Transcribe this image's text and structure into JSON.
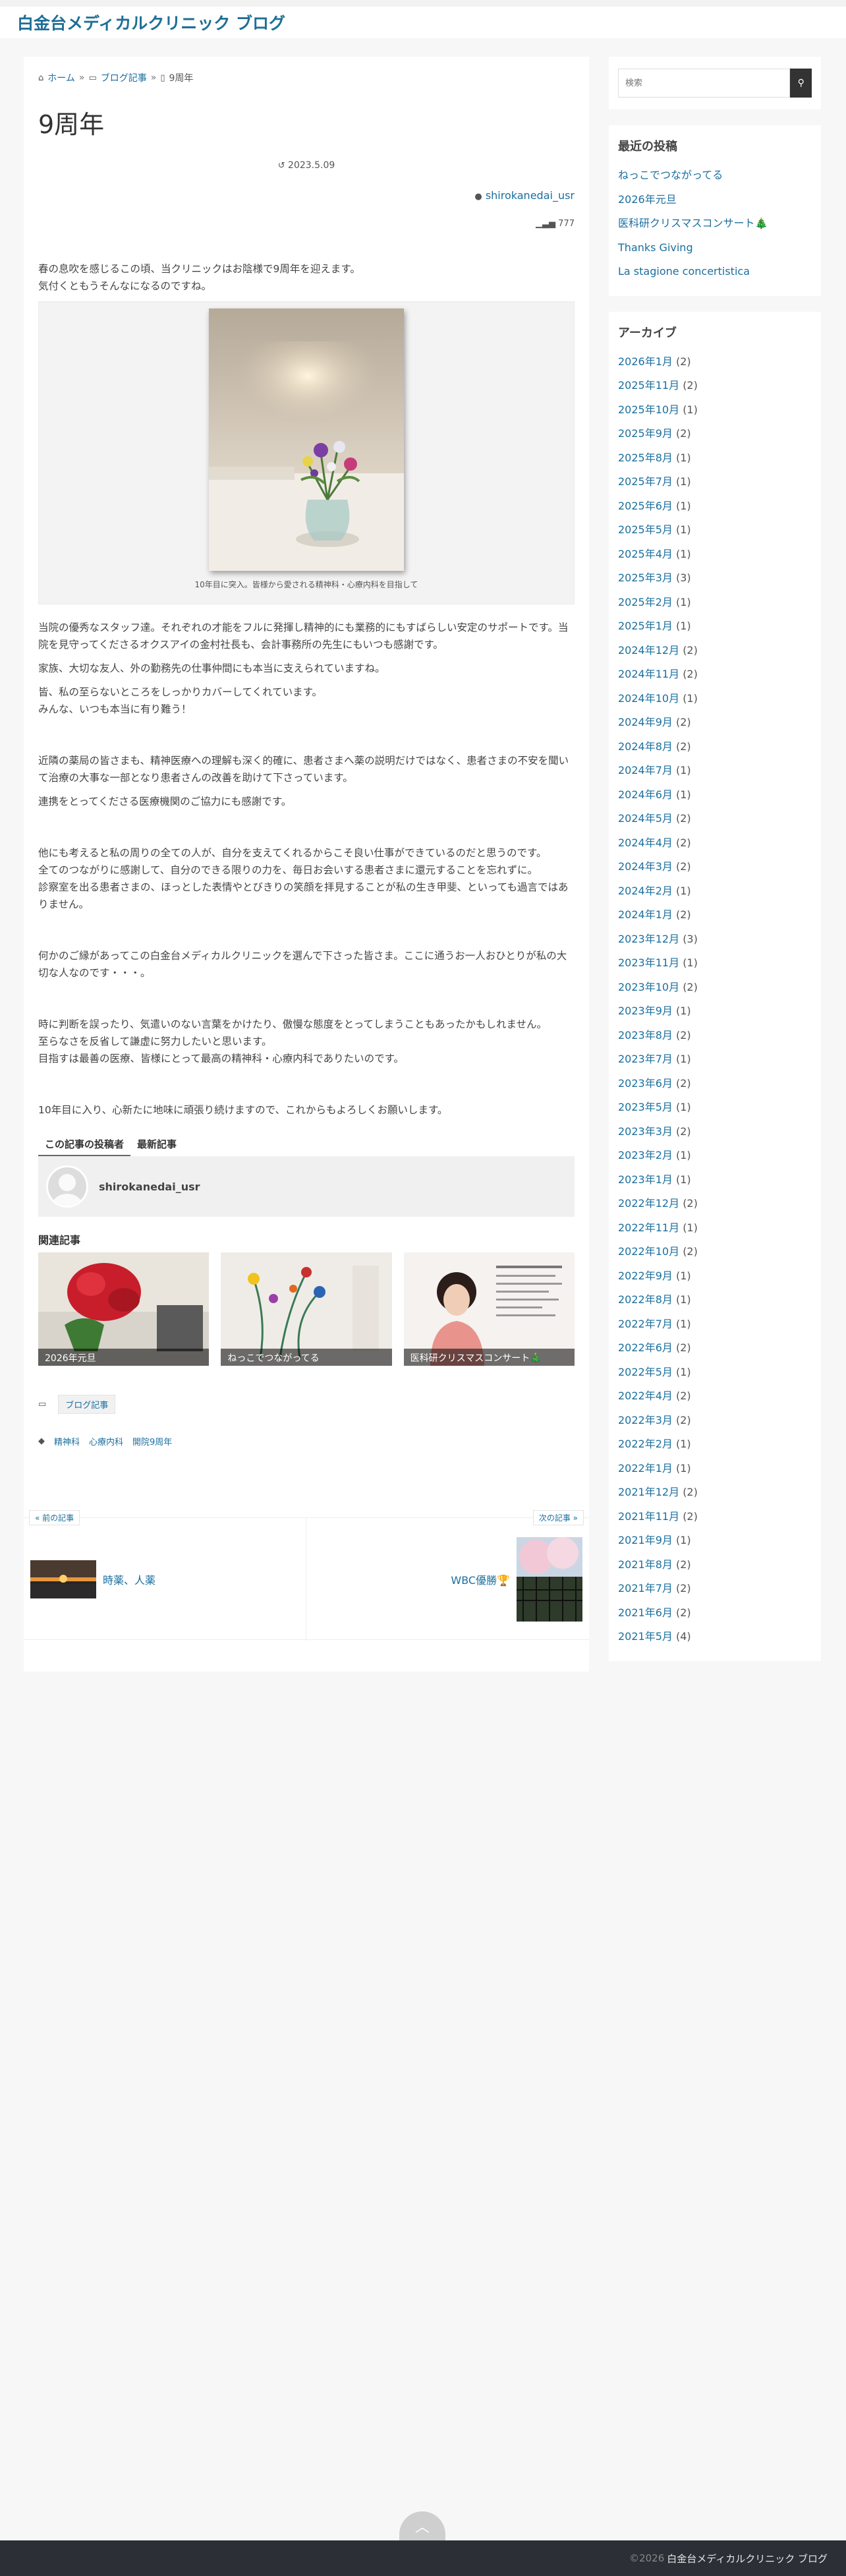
{
  "site": {
    "title": "白金台メディカルクリニック ブログ"
  },
  "breadcrumb": {
    "home": "ホーム",
    "sep1": "»",
    "category": "ブログ記事",
    "sep2": "»",
    "current": "9周年"
  },
  "post": {
    "title": "9周年",
    "date": "2023.5.09",
    "author": "shirokanedai_usr",
    "views": "777",
    "paragraphs_a": [
      "春の息吹を感じるこの頃、当クリニックはお陰様で9周年を迎えます。",
      "気付くともうそんなになるのですね。"
    ],
    "caption": "10年目に突入。皆様から愛される精神科・心療内科を目指して",
    "p1": "当院の優秀なスタッフ達。それぞれの才能をフルに発揮し精神的にも業務的にもすばらしい安定のサポートです。当院を見守ってくださるオクスアイの金村社長も、会計事務所の先生にもいつも感謝です。",
    "p2": "家族、大切な友人、外の勤務先の仕事仲間にも本当に支えられていますね。",
    "p3a": "皆、私の至らないところをしっかりカバーしてくれています。",
    "p3b": "みんな、いつも本当に有り難う！",
    "p4": "近隣の薬局の皆さまも、精神医療への理解も深く的確に、患者さまへ薬の説明だけではなく、患者さまの不安を聞いて治療の大事な一部となり患者さんの改善を助けて下さっています。",
    "p5": "連携をとってくださる医療機関のご協力にも感謝です。",
    "p6a": "他にも考えると私の周りの全ての人が、自分を支えてくれるからこそ良い仕事ができているのだと思うのです。",
    "p6b": "全てのつながりに感謝して、自分のできる限りの力を、毎日お会いする患者さまに還元することを忘れずに。",
    "p6c": "診察室を出る患者さまの、ほっとした表情やとびきりの笑顔を拝見することが私の生き甲斐、といっても過言ではありません。",
    "p7": "何かのご縁があってこの白金台メディカルクリニックを選んで下さった皆さま。ここに通うお一人おひとりが私の大切な人なのです・・・。",
    "p8a": "時に判断を誤ったり、気遣いのない言葉をかけたり、傲慢な態度をとってしまうこともあったかもしれません。",
    "p8b": "至らなさを反省して謙虚に努力したいと思います。",
    "p8c": "目指すは最善の医療、皆様にとって最高の精神科・心療内科でありたいのです。",
    "p9": "10年目に入り、心新たに地味に頑張り続けますので、これからもよろしくお願いします。"
  },
  "author_tabs": {
    "tab1": "この記事の投稿者",
    "tab2": "最新記事"
  },
  "author_box": {
    "name": "shirokanedai_usr"
  },
  "related": {
    "title": "関連記事",
    "items": [
      "2026年元旦",
      "ねっこでつながってる",
      "医科研クリスマスコンサート🎄"
    ]
  },
  "category_pill": "ブログ記事",
  "tags": [
    "精神科",
    "心療内科",
    "開院9周年"
  ],
  "postnav": {
    "prev_label": "« 前の記事",
    "next_label": "次の記事 »",
    "prev_title": "時薬、人薬",
    "next_title": "WBC優勝🏆"
  },
  "sidebar": {
    "search_placeholder": "検索",
    "recent_title": "最近の投稿",
    "recent": [
      "ねっこでつながってる",
      "2026年元旦",
      "医科研クリスマスコンサート🎄",
      "Thanks Giving",
      "La stagione concertistica"
    ],
    "archive_title": "アーカイブ",
    "archives": [
      {
        "label": "2026年1月",
        "count": "(2)"
      },
      {
        "label": "2025年11月",
        "count": "(2)"
      },
      {
        "label": "2025年10月",
        "count": "(1)"
      },
      {
        "label": "2025年9月",
        "count": "(2)"
      },
      {
        "label": "2025年8月",
        "count": "(1)"
      },
      {
        "label": "2025年7月",
        "count": "(1)"
      },
      {
        "label": "2025年6月",
        "count": "(1)"
      },
      {
        "label": "2025年5月",
        "count": "(1)"
      },
      {
        "label": "2025年4月",
        "count": "(1)"
      },
      {
        "label": "2025年3月",
        "count": "(3)"
      },
      {
        "label": "2025年2月",
        "count": "(1)"
      },
      {
        "label": "2025年1月",
        "count": "(1)"
      },
      {
        "label": "2024年12月",
        "count": "(2)"
      },
      {
        "label": "2024年11月",
        "count": "(2)"
      },
      {
        "label": "2024年10月",
        "count": "(1)"
      },
      {
        "label": "2024年9月",
        "count": "(2)"
      },
      {
        "label": "2024年8月",
        "count": "(2)"
      },
      {
        "label": "2024年7月",
        "count": "(1)"
      },
      {
        "label": "2024年6月",
        "count": "(1)"
      },
      {
        "label": "2024年5月",
        "count": "(2)"
      },
      {
        "label": "2024年4月",
        "count": "(2)"
      },
      {
        "label": "2024年3月",
        "count": "(2)"
      },
      {
        "label": "2024年2月",
        "count": "(1)"
      },
      {
        "label": "2024年1月",
        "count": "(2)"
      },
      {
        "label": "2023年12月",
        "count": "(3)"
      },
      {
        "label": "2023年11月",
        "count": "(1)"
      },
      {
        "label": "2023年10月",
        "count": "(2)"
      },
      {
        "label": "2023年9月",
        "count": "(1)"
      },
      {
        "label": "2023年8月",
        "count": "(2)"
      },
      {
        "label": "2023年7月",
        "count": "(1)"
      },
      {
        "label": "2023年6月",
        "count": "(2)"
      },
      {
        "label": "2023年5月",
        "count": "(1)"
      },
      {
        "label": "2023年3月",
        "count": "(2)"
      },
      {
        "label": "2023年2月",
        "count": "(1)"
      },
      {
        "label": "2023年1月",
        "count": "(1)"
      },
      {
        "label": "2022年12月",
        "count": "(2)"
      },
      {
        "label": "2022年11月",
        "count": "(1)"
      },
      {
        "label": "2022年10月",
        "count": "(2)"
      },
      {
        "label": "2022年9月",
        "count": "(1)"
      },
      {
        "label": "2022年8月",
        "count": "(1)"
      },
      {
        "label": "2022年7月",
        "count": "(1)"
      },
      {
        "label": "2022年6月",
        "count": "(2)"
      },
      {
        "label": "2022年5月",
        "count": "(1)"
      },
      {
        "label": "2022年4月",
        "count": "(2)"
      },
      {
        "label": "2022年3月",
        "count": "(2)"
      },
      {
        "label": "2022年2月",
        "count": "(1)"
      },
      {
        "label": "2022年1月",
        "count": "(1)"
      },
      {
        "label": "2021年12月",
        "count": "(2)"
      },
      {
        "label": "2021年11月",
        "count": "(2)"
      },
      {
        "label": "2021年9月",
        "count": "(1)"
      },
      {
        "label": "2021年8月",
        "count": "(2)"
      },
      {
        "label": "2021年7月",
        "count": "(2)"
      },
      {
        "label": "2021年6月",
        "count": "(2)"
      },
      {
        "label": "2021年5月",
        "count": "(4)"
      }
    ]
  },
  "footer": {
    "copy": "©2026",
    "name": "白金台メディカルクリニック ブログ"
  },
  "colors": {
    "link": "#1a6f9e",
    "title": "#1d6f96",
    "footer_bg": "#2c3036"
  }
}
